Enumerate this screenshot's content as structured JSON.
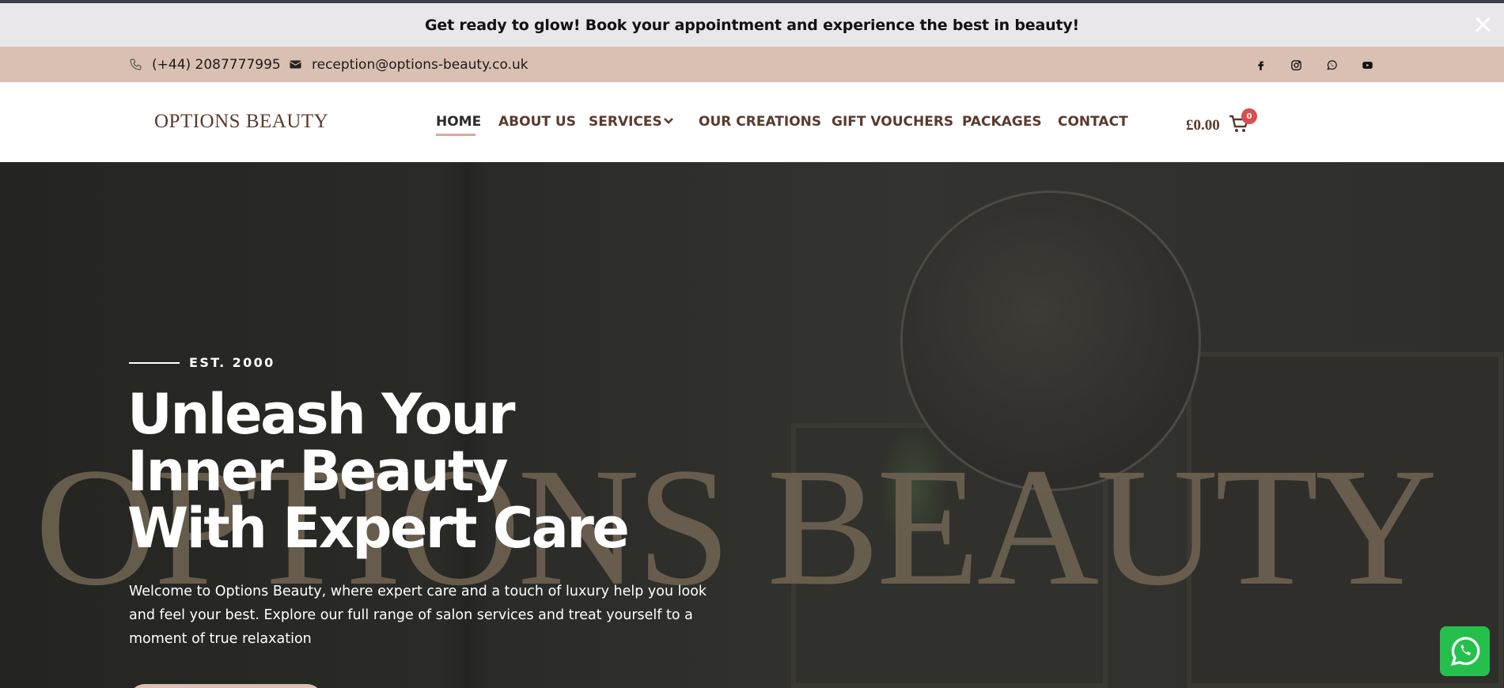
{
  "announcement": {
    "text": "Get ready to glow! Book your appointment and experience the best in beauty!"
  },
  "contact": {
    "phone": "(+44) 2087777995",
    "email": "reception@options-beauty.co.uk"
  },
  "social": [
    "facebook-icon",
    "instagram-icon",
    "whatsapp-icon",
    "youtube-icon"
  ],
  "brand": {
    "logo_text": "OPTIONS BEAUTY"
  },
  "nav": {
    "home": "HOME",
    "about": "ABOUT US",
    "services": "SERVICES",
    "creations": "OUR CREATIONS",
    "vouchers": "GIFT VOUCHERS",
    "packages": "PACKAGES",
    "contact": "CONTACT"
  },
  "cart": {
    "total": "£0.00",
    "count": "0"
  },
  "hero": {
    "watermark": "OPTIONS BEAUTY",
    "est": "EST. 2000",
    "title": "Unleash Your Inner Beauty With Expert Care",
    "description": "Welcome to Options Beauty, where expert care and a touch of luxury help you look and feel your best. Explore our full range of salon services and treat yourself to a moment of true relaxation"
  },
  "colors": {
    "accent": "#d9c0b2",
    "brand_brown": "#5a3a2f",
    "announcement_bg": "#e9e7e9",
    "whatsapp": "#25c04c",
    "badge": "#d94e4e"
  }
}
